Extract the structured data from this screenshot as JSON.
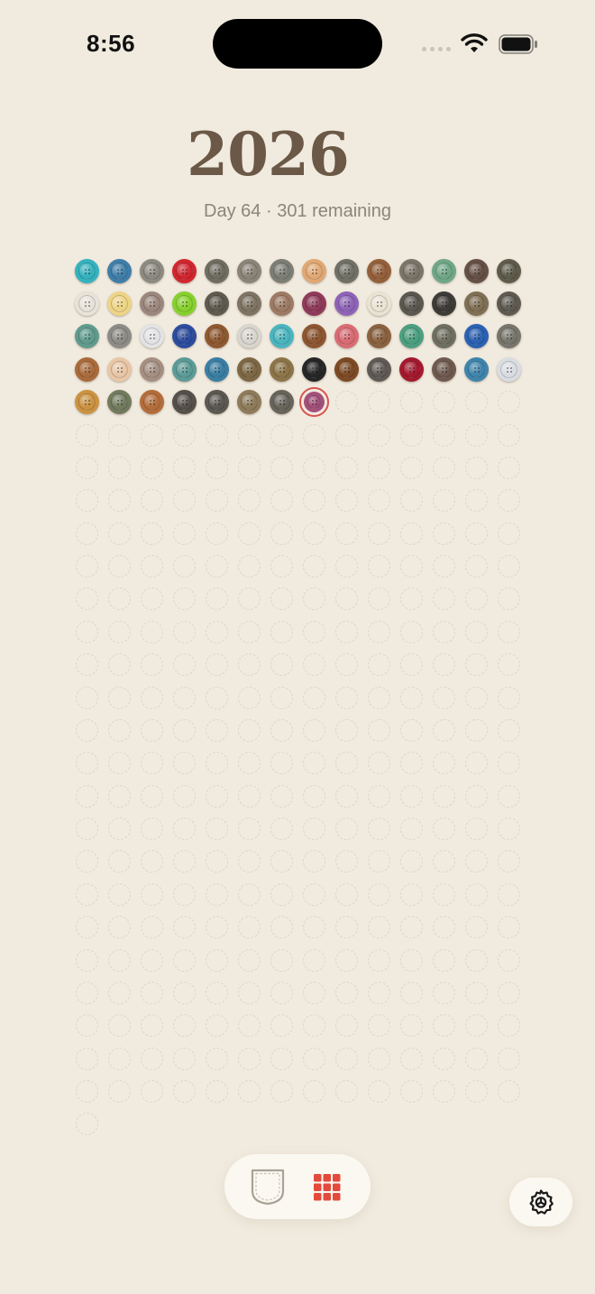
{
  "status_bar": {
    "time": "8:56"
  },
  "header": {
    "year": "2026",
    "day_label": "Day 64",
    "separator": "·",
    "remaining_label": "301 remaining"
  },
  "grid": {
    "total_days": 365,
    "filled_days": 63,
    "today_index": 63,
    "button_colors": [
      "#34b2bf",
      "#3f7ea9",
      "#8c8a80",
      "#d2262f",
      "#6f6c60",
      "#8a8478",
      "#7c7d74",
      "#e1a873",
      "#707066",
      "#94603b",
      "#7b7468",
      "#6fa787",
      "#655045",
      "#5e5b4b",
      "#e7e3d9",
      "#eed486",
      "#9b877d",
      "#86d12c",
      "#5f5a4f",
      "#7f7464",
      "#9d7a64",
      "#8f3a58",
      "#8e63b7",
      "#e9e3d3",
      "#5a5850",
      "#3d3b37",
      "#7f6f54",
      "#5e5a52",
      "#5f9b8d",
      "#8d8b86",
      "#e3e3e5",
      "#2c4c9e",
      "#8e5930",
      "#d8d4ce",
      "#4ab5bf",
      "#8d5630",
      "#d96b73",
      "#8a6240",
      "#4c9f80",
      "#6f6f61",
      "#2a61b3",
      "#77756c",
      "#aa6b3b",
      "#e8c6a6",
      "#a58f82",
      "#5b9b97",
      "#3a7ea3",
      "#7d6744",
      "#8d7448",
      "#262626",
      "#7d4a24",
      "#5f5a55",
      "#a4192e",
      "#6f5a4f",
      "#3e84ad",
      "#d9dde2",
      "#cb9341",
      "#727a5e",
      "#b46d3a",
      "#555049",
      "#5b5852",
      "#8e7b5a",
      "#67645c",
      "#a3517a"
    ]
  },
  "nav": {
    "pocket_icon": "pocket-icon",
    "grid_icon": "grid-icon",
    "settings_icon": "gear-icon",
    "accent_color": "#e34a3b"
  }
}
